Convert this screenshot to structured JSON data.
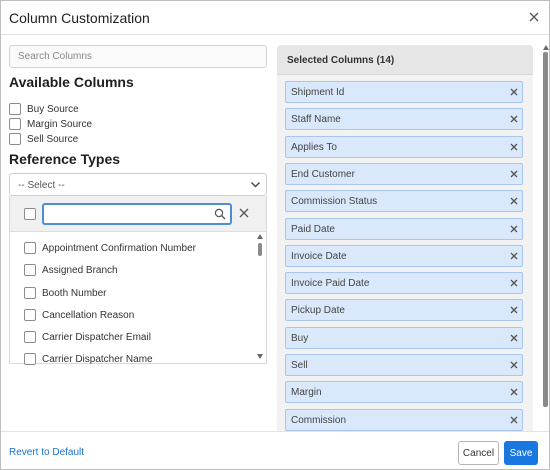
{
  "modal": {
    "title": "Column Customization",
    "close_icon": "close-icon"
  },
  "search": {
    "placeholder": "Search Columns",
    "value": ""
  },
  "available": {
    "heading": "Available Columns",
    "items": [
      {
        "label": "Buy Source",
        "checked": false
      },
      {
        "label": "Margin Source",
        "checked": false
      },
      {
        "label": "Sell Source",
        "checked": false
      }
    ]
  },
  "reference": {
    "heading": "Reference Types",
    "select_value": "-- Select --",
    "dropdown": {
      "search_value": "",
      "options": [
        {
          "label": "Appointment Confirmation Number",
          "checked": false
        },
        {
          "label": "Assigned Branch",
          "checked": false
        },
        {
          "label": "Booth Number",
          "checked": false
        },
        {
          "label": "Cancellation Reason",
          "checked": false
        },
        {
          "label": "Carrier Dispatcher Email",
          "checked": false
        },
        {
          "label": "Carrier Dispatcher Name",
          "checked": false
        }
      ]
    }
  },
  "selected": {
    "title": "Selected Columns (14)",
    "items": [
      "Shipment Id",
      "Staff Name",
      "Applies To",
      "End Customer",
      "Commission Status",
      "Paid Date",
      "Invoice Date",
      "Invoice Paid Date",
      "Pickup Date",
      "Buy",
      "Sell",
      "Margin",
      "Commission"
    ]
  },
  "footer": {
    "revert_label": "Revert to Default",
    "cancel_label": "Cancel",
    "save_label": "Save"
  },
  "colors": {
    "accent": "#1877e0",
    "chip_bg": "#dae8fc",
    "chip_border": "#a9c6ee",
    "link": "#1a73c8",
    "focus_border": "#4a8fd8"
  }
}
